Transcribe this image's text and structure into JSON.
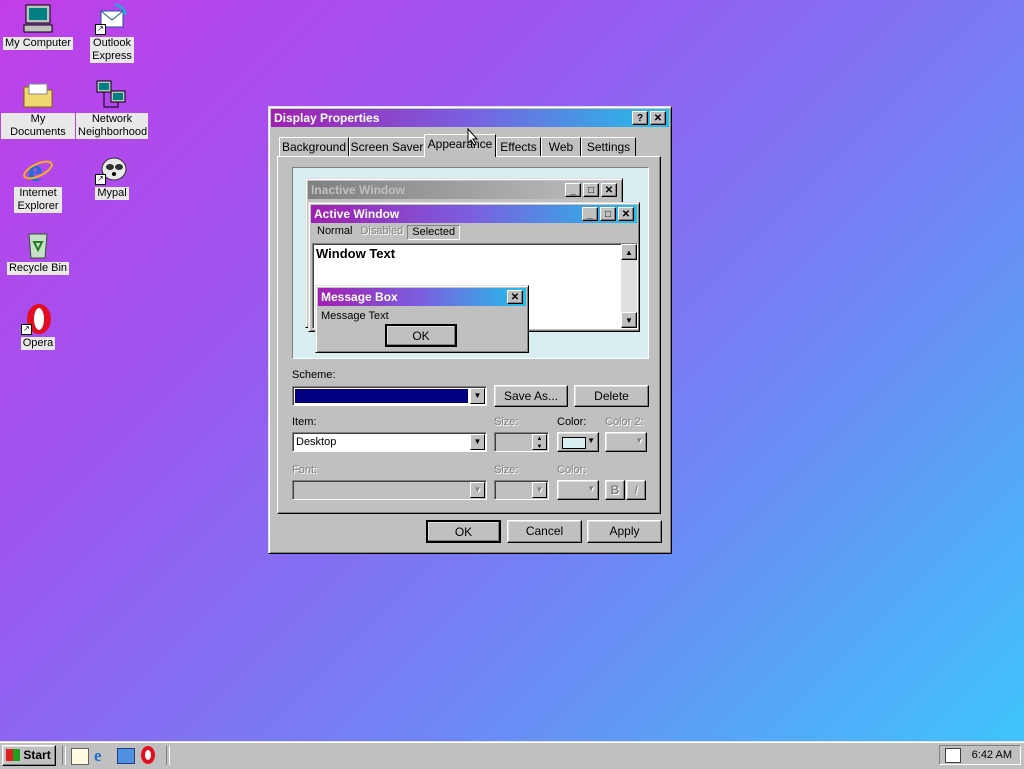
{
  "desktop": {
    "icons": [
      {
        "label": "My Computer"
      },
      {
        "label": "Outlook Express"
      },
      {
        "label": "My Documents"
      },
      {
        "label": "Network Neighborhood"
      },
      {
        "label": "Internet Explorer"
      },
      {
        "label": "Mypal"
      },
      {
        "label": "Recycle Bin"
      },
      {
        "label": "Opera"
      }
    ]
  },
  "dialog": {
    "title": "Display Properties",
    "help_glyph": "?",
    "close_glyph": "✕",
    "tabs": [
      "Background",
      "Screen Saver",
      "Appearance",
      "Effects",
      "Web",
      "Settings"
    ],
    "preview": {
      "inactive_title": "Inactive Window",
      "active_title": "Active Window",
      "menu": {
        "normal": "Normal",
        "disabled": "Disabled",
        "selected": "Selected"
      },
      "window_text": "Window Text",
      "message_box_title": "Message Box",
      "message_text": "Message Text",
      "ok_label": "OK"
    },
    "scheme": {
      "label": "Scheme:",
      "value": "",
      "save_as": "Save As...",
      "delete": "Delete"
    },
    "item": {
      "label": "Item:",
      "value": "Desktop",
      "size_label": "Size:",
      "color_label": "Color:",
      "color2_label": "Color 2:"
    },
    "font": {
      "label": "Font:",
      "size_label": "Size:",
      "color_label": "Color:",
      "bold": "B",
      "italic": "I"
    },
    "buttons": {
      "ok": "OK",
      "cancel": "Cancel",
      "apply": "Apply"
    }
  },
  "taskbar": {
    "start_label": "Start",
    "clock": "6:42 AM"
  },
  "colors": {
    "selection": "#000080",
    "preview_bg": "#d8eef0"
  }
}
